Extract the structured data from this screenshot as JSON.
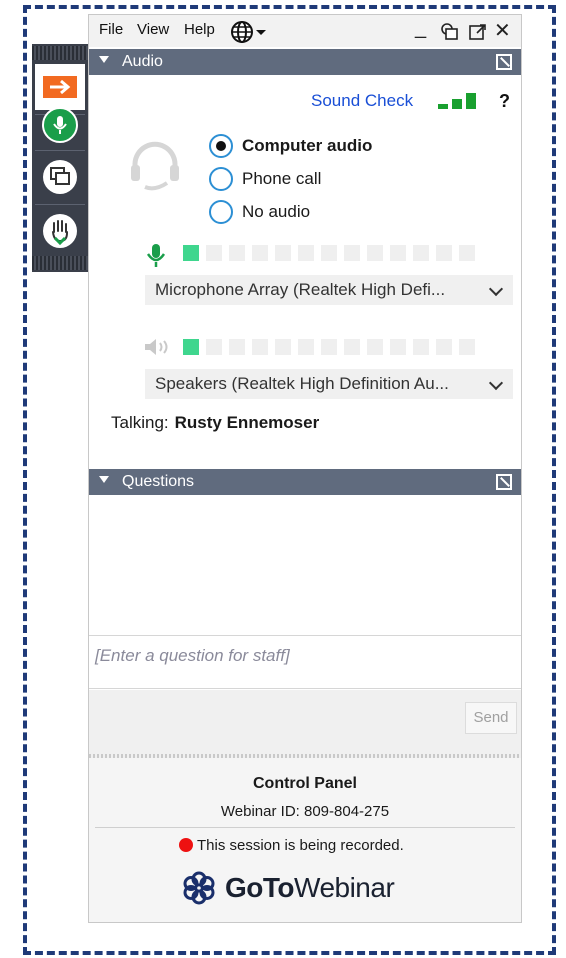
{
  "menu": {
    "file": "File",
    "view": "View",
    "help": "Help"
  },
  "window": {
    "minimize": "_",
    "close": "✕"
  },
  "audio": {
    "header": "Audio",
    "sound_check": "Sound Check",
    "help": "?",
    "options": [
      {
        "label": "Computer audio",
        "selected": true
      },
      {
        "label": "Phone call",
        "selected": false
      },
      {
        "label": "No audio",
        "selected": false
      }
    ],
    "microphone_select": "Microphone Array (Realtek High Defi...",
    "speaker_select": "Speakers (Realtek High Definition Au...",
    "mic_level_segments_on": 1,
    "speaker_level_segments_on": 1,
    "level_segments_total": 13,
    "talking_label": "Talking:",
    "talking_name": "Rusty Ennemoser"
  },
  "questions": {
    "header": "Questions",
    "placeholder": "[Enter a question for staff]",
    "send": "Send"
  },
  "footer": {
    "title": "Control Panel",
    "webinar_id": "Webinar ID: 809-804-275",
    "recording": "This session is being recorded.",
    "brand_bold": "GoTo",
    "brand_regular": "Webinar"
  },
  "colors": {
    "header_bg": "#606b7e",
    "accent_link": "#1a4fd6",
    "level_on": "#3fd68e",
    "recording_dot": "#ee1111",
    "frame_dash": "#1f3a78"
  },
  "icons": {
    "sidebar": [
      "arrow-right-icon",
      "microphone-icon",
      "screen-share-icon",
      "raise-hand-icon"
    ],
    "audio": [
      "headset-icon",
      "signal-bars-icon",
      "microphone-icon",
      "speaker-icon"
    ]
  }
}
